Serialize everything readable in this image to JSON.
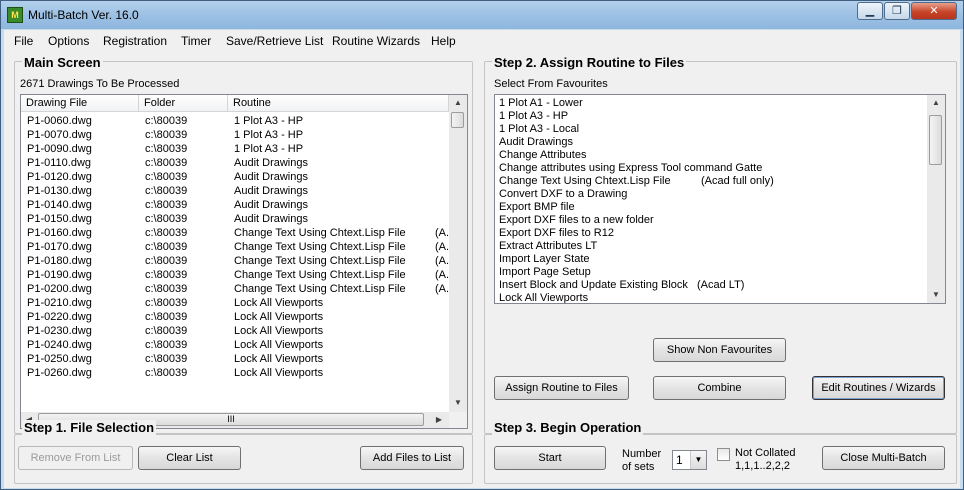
{
  "window": {
    "title": "Multi-Batch Ver. 16.0",
    "controls": {
      "minimize": "▁",
      "maximize": "❐",
      "close": "✕"
    }
  },
  "menu": [
    "File",
    "Options",
    "Registration",
    "Timer",
    "Save/Retrieve List",
    "Routine Wizards",
    "Help"
  ],
  "main_screen": {
    "title": "Main Screen",
    "count_label": "2671 Drawings To Be Processed",
    "columns": [
      "Drawing File",
      "Folder",
      "Routine"
    ],
    "rows": [
      {
        "file": "P1-0060.dwg",
        "folder": "c:\\80039",
        "routine": "1 Plot A3 - HP",
        "extra": ""
      },
      {
        "file": "P1-0070.dwg",
        "folder": "c:\\80039",
        "routine": "1 Plot A3 - HP",
        "extra": ""
      },
      {
        "file": "P1-0090.dwg",
        "folder": "c:\\80039",
        "routine": "1 Plot A3 - HP",
        "extra": ""
      },
      {
        "file": "P1-0110.dwg",
        "folder": "c:\\80039",
        "routine": "Audit Drawings",
        "extra": ""
      },
      {
        "file": "P1-0120.dwg",
        "folder": "c:\\80039",
        "routine": "Audit Drawings",
        "extra": ""
      },
      {
        "file": "P1-0130.dwg",
        "folder": "c:\\80039",
        "routine": "Audit Drawings",
        "extra": ""
      },
      {
        "file": "P1-0140.dwg",
        "folder": "c:\\80039",
        "routine": "Audit Drawings",
        "extra": ""
      },
      {
        "file": "P1-0150.dwg",
        "folder": "c:\\80039",
        "routine": "Audit Drawings",
        "extra": ""
      },
      {
        "file": "P1-0160.dwg",
        "folder": "c:\\80039",
        "routine": "Change Text Using Chtext.Lisp File",
        "extra": "(A."
      },
      {
        "file": "P1-0170.dwg",
        "folder": "c:\\80039",
        "routine": "Change Text Using Chtext.Lisp File",
        "extra": "(A."
      },
      {
        "file": "P1-0180.dwg",
        "folder": "c:\\80039",
        "routine": "Change Text Using Chtext.Lisp File",
        "extra": "(A."
      },
      {
        "file": "P1-0190.dwg",
        "folder": "c:\\80039",
        "routine": "Change Text Using Chtext.Lisp File",
        "extra": "(A."
      },
      {
        "file": "P1-0200.dwg",
        "folder": "c:\\80039",
        "routine": "Change Text Using Chtext.Lisp File",
        "extra": "(A."
      },
      {
        "file": "P1-0210.dwg",
        "folder": "c:\\80039",
        "routine": "Lock All Viewports",
        "extra": ""
      },
      {
        "file": "P1-0220.dwg",
        "folder": "c:\\80039",
        "routine": "Lock All Viewports",
        "extra": ""
      },
      {
        "file": "P1-0230.dwg",
        "folder": "c:\\80039",
        "routine": "Lock All Viewports",
        "extra": ""
      },
      {
        "file": "P1-0240.dwg",
        "folder": "c:\\80039",
        "routine": "Lock All Viewports",
        "extra": ""
      },
      {
        "file": "P1-0250.dwg",
        "folder": "c:\\80039",
        "routine": "Lock All Viewports",
        "extra": ""
      },
      {
        "file": "P1-0260.dwg",
        "folder": "c:\\80039",
        "routine": "Lock All Viewports",
        "extra": ""
      }
    ],
    "hscroll_grip": "III"
  },
  "step1": {
    "title": "Step 1. File Selection",
    "remove_button": "Remove From List",
    "clear_button": "Clear List",
    "add_button": "Add Files to List"
  },
  "step2": {
    "title": "Step 2.  Assign Routine to Files",
    "select_label": "Select From Favourites",
    "favourites": [
      {
        "name": "1 Plot A1 - Lower",
        "extra": ""
      },
      {
        "name": "1 Plot A3 - HP",
        "extra": ""
      },
      {
        "name": "1 Plot A3 - Local",
        "extra": ""
      },
      {
        "name": "Audit Drawings",
        "extra": ""
      },
      {
        "name": "Change Attributes",
        "extra": ""
      },
      {
        "name": "Change attributes using Express Tool command Gatte",
        "extra": ""
      },
      {
        "name": "Change Text Using Chtext.Lisp File",
        "extra": "(Acad full only)"
      },
      {
        "name": "Convert DXF to a Drawing",
        "extra": ""
      },
      {
        "name": "Export BMP file",
        "extra": ""
      },
      {
        "name": "Export DXF files to a new folder",
        "extra": ""
      },
      {
        "name": "Export DXF files to R12",
        "extra": ""
      },
      {
        "name": "Extract Attributes LT",
        "extra": ""
      },
      {
        "name": "Import Layer State",
        "extra": ""
      },
      {
        "name": "Import Page Setup",
        "extra": ""
      },
      {
        "name": "Insert Block and Update Existing Block",
        "extra": "(Acad LT)"
      },
      {
        "name": "Lock All Viewports",
        "extra": ""
      }
    ],
    "show_non_favourites_button": "Show Non Favourites",
    "assign_button": "Assign Routine to Files",
    "combine_button": "Combine",
    "edit_button": "Edit Routines / Wizards"
  },
  "step3": {
    "title": "Step 3. Begin Operation",
    "start_button": "Start",
    "sets_label_1": "Number",
    "sets_label_2": "of sets",
    "sets_value": "1",
    "not_collated_1": "Not Collated",
    "not_collated_2": "1,1,1..2,2,2",
    "close_button": "Close Multi-Batch"
  }
}
